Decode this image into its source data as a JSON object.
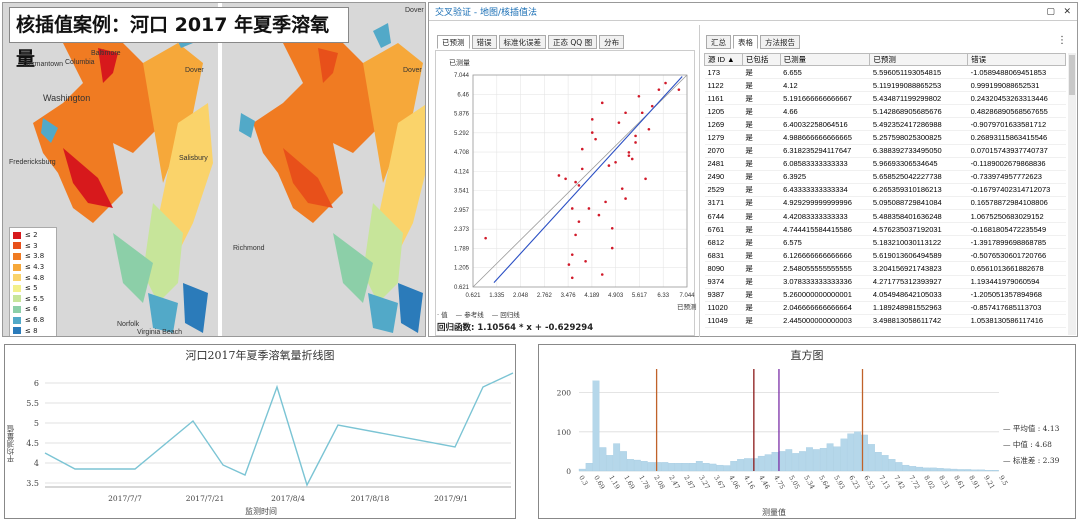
{
  "map_panel": {
    "title": "核插值案例：河口 2017 年夏季溶氧量",
    "place_labels": [
      "Baltimore",
      "Columbia",
      "Germantown",
      "Washington",
      "Dover",
      "Dover",
      "Fredericksburg",
      "Salisbury",
      "Richmond",
      "Norfolk",
      "Virginia Beach",
      "Dover"
    ],
    "legend": [
      {
        "label": "≤ 2",
        "color": "#d7191c"
      },
      {
        "label": "≤ 3",
        "color": "#e8501a"
      },
      {
        "label": "≤ 3.8",
        "color": "#f07b22"
      },
      {
        "label": "≤ 4.3",
        "color": "#f6a83a"
      },
      {
        "label": "≤ 4.8",
        "color": "#fad36a"
      },
      {
        "label": "≤ 5",
        "color": "#f3f08a"
      },
      {
        "label": "≤ 5.5",
        "color": "#c7e59a"
      },
      {
        "label": "≤ 6",
        "color": "#8ccfa8"
      },
      {
        "label": "≤ 6.8",
        "color": "#52a9c8"
      },
      {
        "label": "≤ 8",
        "color": "#2b7bba"
      }
    ]
  },
  "cv": {
    "title": "交叉验证 - 地图/核插值法",
    "window_controls": [
      "▢",
      "✕"
    ],
    "left_tabs": [
      "已预测",
      "错误",
      "标准化误差",
      "正态 QQ 图",
      "分布"
    ],
    "right_tabs": [
      "汇总",
      "表格",
      "方法报告"
    ],
    "chart_ylabel": "已测量",
    "chart_xlabel": "已预测",
    "legend_text": [
      "· 值",
      "— 参考线",
      "— 回归线"
    ],
    "regression": "回归函数: 1.10564 * x + -0.629294",
    "yticks": [
      "7.044",
      "6.46",
      "5.876",
      "5.292",
      "4.708",
      "4.124",
      "3.541",
      "2.957",
      "2.373",
      "1.789",
      "1.205",
      "0.621"
    ],
    "xticks": [
      "0.621",
      "1.335",
      "2.048",
      "2.762",
      "3.476",
      "4.189",
      "4.903",
      "5.617",
      "6.33",
      "7.044"
    ],
    "table_headers": [
      "源 ID ▲",
      "已包括",
      "已测量",
      "已预测",
      "错误"
    ],
    "rows": [
      [
        "173",
        "是",
        "6.655",
        "5.596051193054815",
        "-1.0589488069451853"
      ],
      [
        "1122",
        "是",
        "4.12",
        "5.119199088865253",
        "0.999199088652531"
      ],
      [
        "1161",
        "是",
        "5.191666666666667",
        "5.434871199299802",
        "0.24320453263313446"
      ],
      [
        "1205",
        "是",
        "4.66",
        "5.142868905685676",
        "0.48286890568567655"
      ],
      [
        "1269",
        "是",
        "6.40032258064516",
        "5.492352417286988",
        "-0.9079701633581712"
      ],
      [
        "1279",
        "是",
        "4.988666666666665",
        "5.257598025300825",
        "0.26893115863415546"
      ],
      [
        "2070",
        "是",
        "6.318235294117647",
        "6.388392733495050",
        "0.07015743937740737"
      ],
      [
        "2481",
        "是",
        "6.08583333333333",
        "5.96693306534645",
        "-0.1189002679868836"
      ],
      [
        "2490",
        "是",
        "6.3925",
        "5.658525042227738",
        "-0.733974957772623"
      ],
      [
        "2529",
        "是",
        "6.43333333333334",
        "6.265359310186213",
        "-0.16797402314712073"
      ],
      [
        "3171",
        "是",
        "4.929299999999996",
        "5.095088729841084",
        "0.16578872984108806"
      ],
      [
        "6744",
        "是",
        "4.42083333333333",
        "5.488358401636248",
        "1.0675250683029152"
      ],
      [
        "6761",
        "是",
        "4.744415584415586",
        "4.576235037192031",
        "-0.1681805472235549"
      ],
      [
        "6812",
        "是",
        "6.575",
        "5.183210030113122",
        "-1.3917899698868785"
      ],
      [
        "6831",
        "是",
        "6.126666666666666",
        "5.619013606494589",
        "-0.5076530601720766"
      ],
      [
        "8090",
        "是",
        "2.548055555555555",
        "3.204156921743823",
        "0.6561013661882678"
      ],
      [
        "9374",
        "是",
        "3.078333333333336",
        "4.271775312393927",
        "1.193441979060594"
      ],
      [
        "9387",
        "是",
        "5.260000000000001",
        "4.054948642105033",
        "-1.205051357894968"
      ],
      [
        "11020",
        "是",
        "2.046666666666664",
        "1.189248981552963",
        "-0.857417685113703"
      ],
      [
        "11049",
        "是",
        "2.445000000000003",
        "3.498813058611742",
        "1.0538130586117416"
      ]
    ]
  },
  "line_chart": {
    "title": "河口2017年夏季溶氧量折线图",
    "xlabel": "监测时间",
    "ylabel": "平均测量值"
  },
  "hist_chart": {
    "title": "直方图",
    "xlabel": "测量值",
    "stats": [
      "平均值 : 4.13",
      "中值 : 4.68",
      "标准差 : 2.39"
    ],
    "xticks": [
      "0.3",
      "0.69",
      "1.19",
      "1.69",
      "1.78",
      "2.08",
      "2.47",
      "2.87",
      "3.27",
      "3.67",
      "4.06",
      "4.16",
      "4.46",
      "4.75",
      "5.05",
      "5.34",
      "5.64",
      "5.93",
      "6.23",
      "6.53",
      "7.13",
      "7.42",
      "7.72",
      "8.02",
      "8.31",
      "8.61",
      "8.91",
      "9.21",
      "9.5"
    ]
  },
  "chart_data": [
    {
      "type": "scatter",
      "title": "",
      "xlabel": "已预测",
      "ylabel": "已测量",
      "xlim": [
        0.621,
        7.044
      ],
      "ylim": [
        0.621,
        7.044
      ],
      "x": [
        1.0,
        3.2,
        3.4,
        3.5,
        3.6,
        3.7,
        3.8,
        3.9,
        4.0,
        4.1,
        4.2,
        4.3,
        4.4,
        4.5,
        4.6,
        4.7,
        4.8,
        4.9,
        5.0,
        5.1,
        5.2,
        5.3,
        5.4,
        5.5,
        5.6,
        5.7,
        5.8,
        5.9,
        6.0,
        6.2,
        3.7,
        3.8,
        3.6,
        4.5,
        5.3,
        3.9,
        3.6,
        4.8,
        5.2,
        6.4,
        6.8,
        5.5,
        4.2
      ],
      "y": [
        2.1,
        4.0,
        3.9,
        1.3,
        1.6,
        3.8,
        2.6,
        4.2,
        1.4,
        3.0,
        5.7,
        5.1,
        2.8,
        1.0,
        3.2,
        4.3,
        1.8,
        4.4,
        5.6,
        3.6,
        5.9,
        4.7,
        4.5,
        5.2,
        6.4,
        5.9,
        3.9,
        5.4,
        6.1,
        6.6,
        2.2,
        3.7,
        3.0,
        6.2,
        4.6,
        4.8,
        0.9,
        2.4,
        3.3,
        6.8,
        6.6,
        5.0,
        5.3
      ]
    },
    {
      "type": "line",
      "title": "河口2017年夏季溶氧量折线图",
      "xlabel": "监测时间",
      "ylabel": "平均测量值",
      "ylim": [
        3.5,
        6.3
      ],
      "x": [
        "2017/6/28",
        "2017/7/2",
        "2017/7/9",
        "2017/7/16",
        "2017/7/23",
        "2017/7/28",
        "2017/8/1",
        "2017/8/6",
        "2017/8/9",
        "2017/8/16",
        "2017/9/6",
        "2017/9/9",
        "2017/9/13"
      ],
      "tick_labels": [
        "2017/7/7",
        "2017/7/21",
        "2017/8/4",
        "2017/8/18",
        "2017/9/1"
      ],
      "yticks": [
        "6",
        "5.5",
        "5",
        "4.5",
        "4",
        "3.5"
      ],
      "values": [
        4.25,
        3.85,
        3.85,
        3.85,
        5.05,
        3.95,
        3.7,
        5.9,
        3.45,
        4.95,
        4.4,
        5.9,
        6.25
      ]
    },
    {
      "type": "bar",
      "title": "直方图",
      "xlabel": "测量值",
      "ylim": [
        0,
        250
      ],
      "yticks": [
        "200",
        "100",
        "0"
      ],
      "values": [
        5,
        20,
        230,
        60,
        40,
        70,
        50,
        30,
        28,
        25,
        22,
        22,
        22,
        20,
        20,
        20,
        20,
        25,
        20,
        18,
        15,
        14,
        25,
        30,
        32,
        32,
        38,
        42,
        48,
        50,
        55,
        45,
        50,
        60,
        55,
        58,
        70,
        62,
        82,
        95,
        100,
        92,
        68,
        48,
        40,
        30,
        22,
        15,
        12,
        10,
        8,
        8,
        7,
        6,
        5,
        4,
        4,
        3,
        3,
        2,
        2
      ],
      "vlines": [
        {
          "value": 2.0,
          "color": "#c0622a"
        },
        {
          "value": 4.13,
          "color": "#8b1a1a"
        },
        {
          "value": 4.68,
          "color": "#7b2fa8"
        },
        {
          "value": 6.51,
          "color": "#c0622a"
        }
      ]
    }
  ]
}
